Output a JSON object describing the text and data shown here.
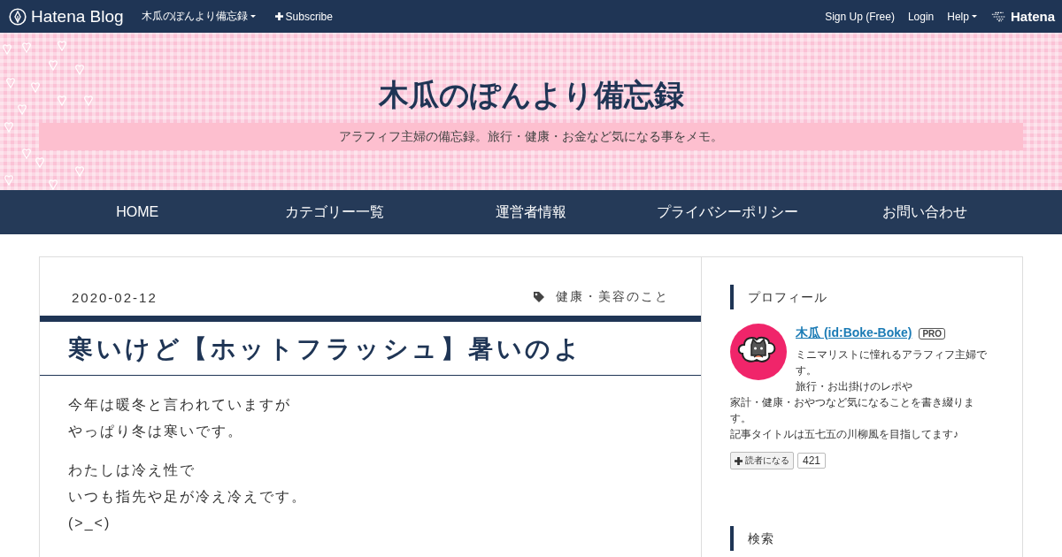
{
  "topbar": {
    "brand": "Hatena Blog",
    "blog_menu": "木瓜のぽんより備忘録",
    "subscribe": "Subscribe",
    "links": [
      {
        "label": "Sign Up (Free)",
        "dropdown": false
      },
      {
        "label": "Login",
        "dropdown": false
      },
      {
        "label": "Help",
        "dropdown": true
      }
    ],
    "hatena": "Hatena"
  },
  "header": {
    "title": "木瓜のぽんより備忘録",
    "description": "アラフィフ主婦の備忘録。旅行・健康・お金など気になる事をメモ。"
  },
  "nav": [
    "HOME",
    "カテゴリー一覧",
    "運営者情報",
    "プライバシーポリシー",
    "お問い合わせ"
  ],
  "article": {
    "date": "2020-02-12",
    "category": "健康・美容のこと",
    "title": "寒いけど【ホットフラッシュ】暑いのよ",
    "paragraphs": [
      [
        "今年は暖冬と言われていますが",
        "やっぱり冬は寒いです。"
      ],
      [
        "わたしは冷え性で",
        "いつも指先や足が冷え冷えです。",
        "(>_<)"
      ]
    ]
  },
  "sidebar": {
    "profile": {
      "heading": "プロフィール",
      "name": "木瓜 (id:Boke-Boke)",
      "badge": "PRO",
      "description": [
        "ミニマリストに憧れるアラフィフ主婦です。",
        "旅行・お出掛けのレポや",
        "家計・健康・おやつなど気になることを書き綴ります。",
        "記事タイトルは五七五の川柳風を目指してます♪"
      ],
      "subscribe": "読者になる",
      "count": "421"
    },
    "search_heading": "検索"
  }
}
